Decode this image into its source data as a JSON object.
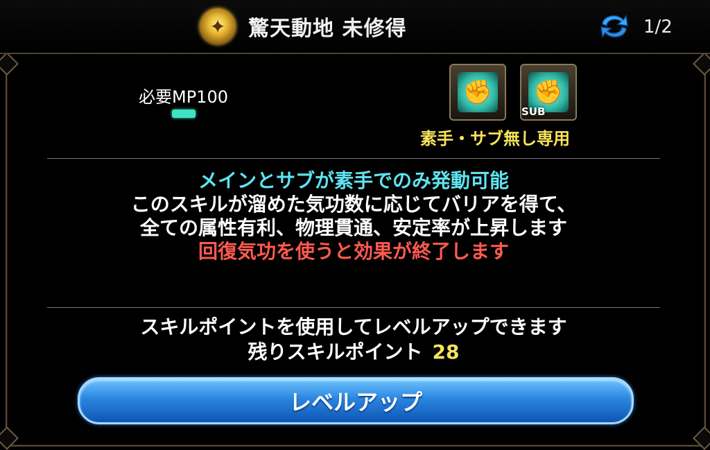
{
  "header": {
    "skill_icon": "golden-ornament-icon",
    "title": "驚天動地 未修得",
    "page_indicator": "1/2",
    "swap_icon": "refresh-arrows-icon"
  },
  "requirements": {
    "mp_label": "必要MP100",
    "mp_bar_color": "#3fe3c2"
  },
  "weapons": {
    "main_icon": "fist-icon",
    "sub_icon": "fist-icon",
    "sub_label": "SUB",
    "restriction": "素手・サブ無し専用"
  },
  "description": {
    "line_condition": "メインとサブが素手でのみ発動可能",
    "line_effect_1": "このスキルが溜めた気功数に応じてバリアを得て、",
    "line_effect_2": "全ての属性有利、物理貫通、安定率が上昇します",
    "line_warning": "回復気功を使うと効果が終了します"
  },
  "skill_points": {
    "info": "スキルポイントを使用してレベルアップできます",
    "remaining_label": "残りスキルポイント",
    "remaining_value": "28"
  },
  "actions": {
    "levelup_label": "レベルアップ"
  },
  "colors": {
    "cyan_text": "#5fe3f0",
    "red_text": "#ff5a50",
    "yellow_text": "#f6e35a",
    "button_blue": "#2a86e0"
  }
}
